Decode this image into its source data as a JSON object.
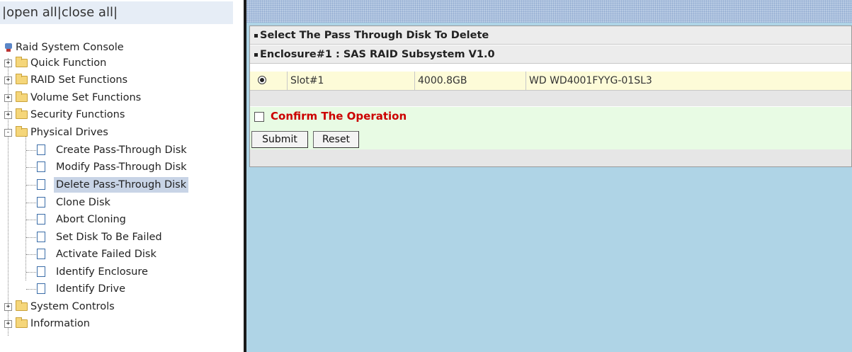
{
  "nav": {
    "open_all": "open all",
    "close_all": "close all",
    "sep": "|",
    "root": "Raid System Console",
    "items": [
      {
        "label": "Quick Function",
        "toggle": "+"
      },
      {
        "label": "RAID Set Functions",
        "toggle": "+"
      },
      {
        "label": "Volume Set Functions",
        "toggle": "+"
      },
      {
        "label": "Security Functions",
        "toggle": "+"
      },
      {
        "label": "Physical Drives",
        "toggle": "-"
      },
      {
        "label": "System Controls",
        "toggle": "+"
      },
      {
        "label": "Information",
        "toggle": "+"
      }
    ],
    "physical_drives_children": [
      "Create Pass-Through Disk",
      "Modify Pass-Through Disk",
      "Delete Pass-Through Disk",
      "Clone Disk",
      "Abort Cloning",
      "Set Disk To Be Failed",
      "Activate Failed Disk",
      "Identify Enclosure",
      "Identify Drive"
    ],
    "selected": "Delete Pass-Through Disk"
  },
  "main": {
    "title": "Select The Pass Through Disk To Delete",
    "enclosure": "Enclosure#1 : SAS RAID Subsystem V1.0",
    "disks": [
      {
        "selected": true,
        "slot": "Slot#1",
        "size": "4000.8GB",
        "model": "WD WD4001FYYG-01SL3"
      }
    ],
    "confirm_label": "Confirm The Operation",
    "confirm_checked": false,
    "submit_label": "Submit",
    "reset_label": "Reset"
  },
  "colors": {
    "content_bg": "#afd4e6",
    "confirm_text": "#cc0000",
    "row_highlight": "#fdfbd8",
    "confirm_bg": "#e8fbe4",
    "selected_nav": "#c8d4e6"
  }
}
